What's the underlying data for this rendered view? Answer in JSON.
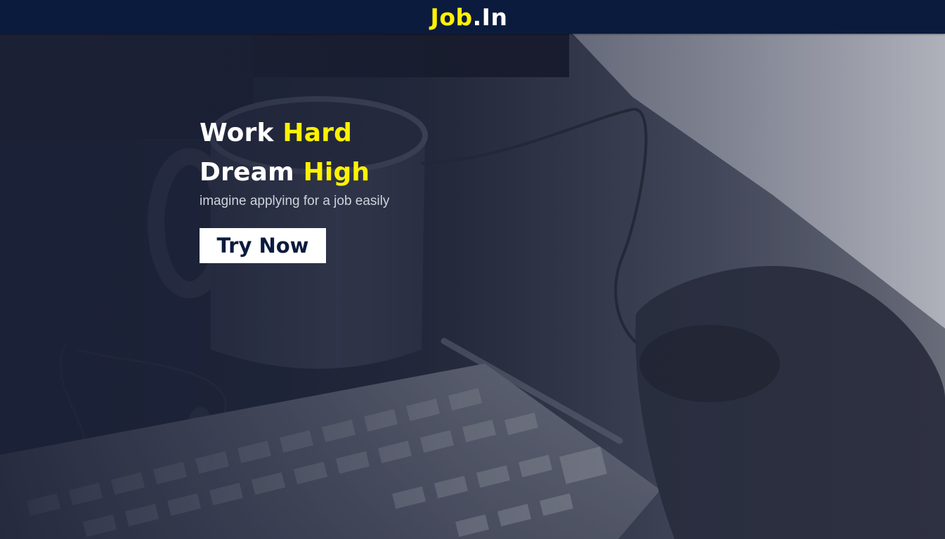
{
  "brand": {
    "part1": "Job",
    "part2": ".In"
  },
  "hero": {
    "line1": {
      "word1": "Work",
      "word2": "Hard"
    },
    "line2": {
      "word1": "Dream",
      "word2": "High"
    },
    "tagline": "imagine applying for a job easily",
    "cta_label": "Try Now"
  },
  "colors": {
    "navbar": "#0b1b3e",
    "accent": "#fff200",
    "text": "#ffffff",
    "overlay": "#1b2136"
  }
}
